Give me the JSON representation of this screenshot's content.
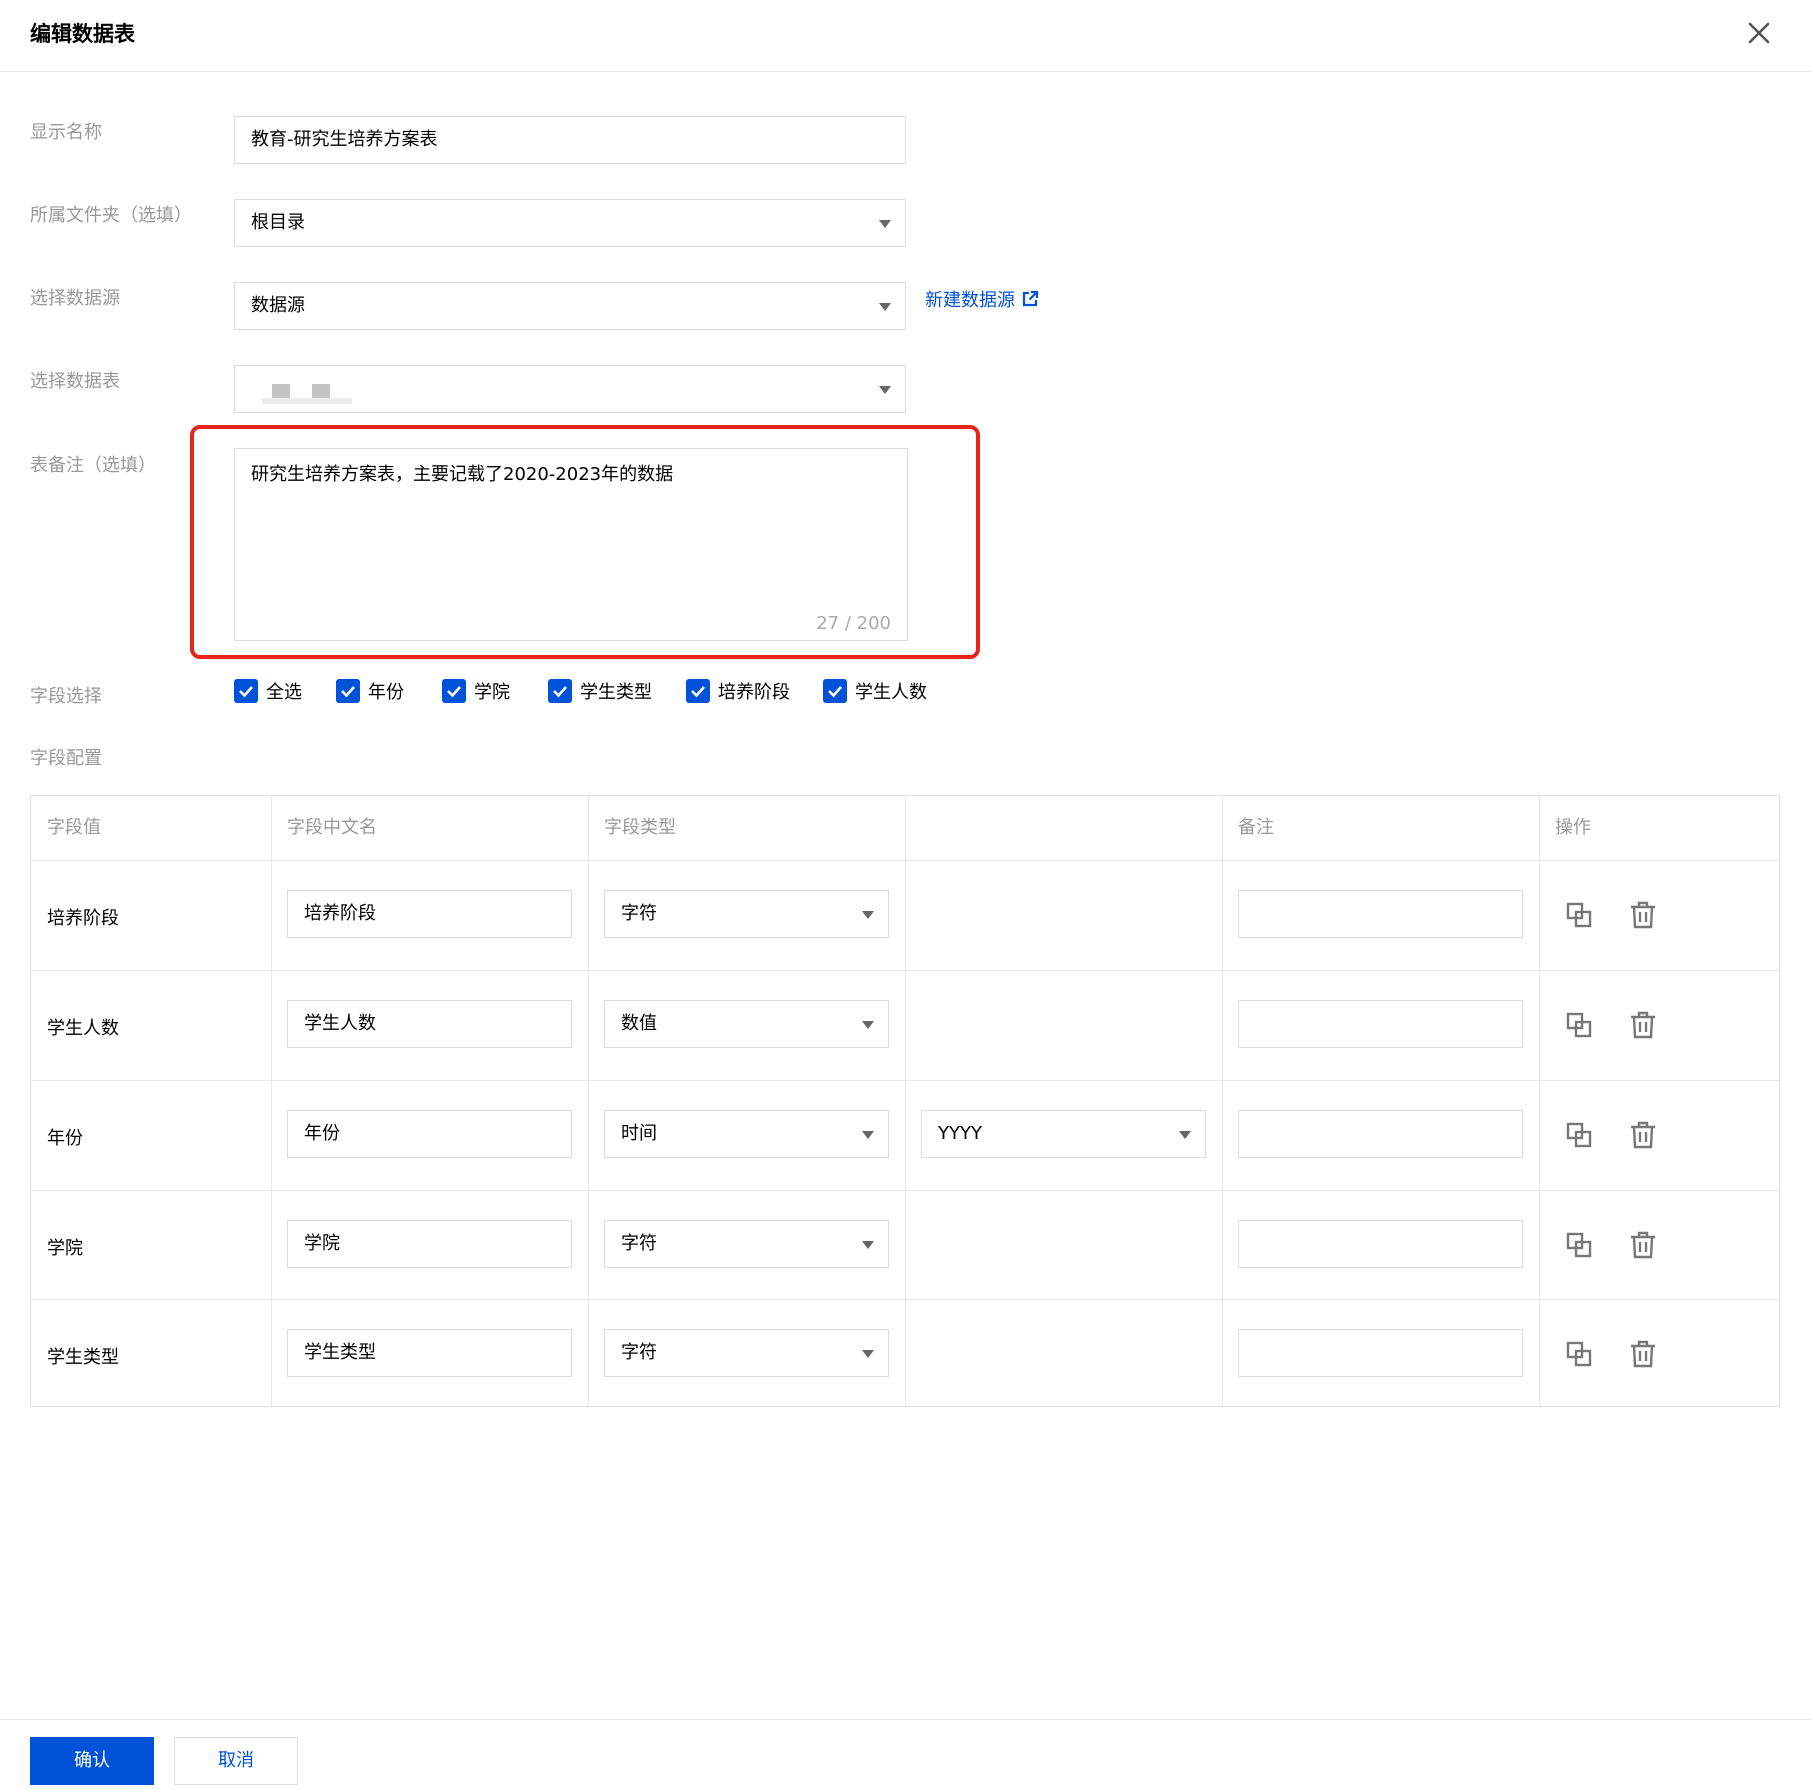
{
  "header": {
    "title": "编辑数据表"
  },
  "form": {
    "display_name": {
      "label": "显示名称",
      "value": "教育-研究生培养方案表"
    },
    "folder": {
      "label": "所属文件夹（选填）",
      "value": "根目录"
    },
    "datasource": {
      "label": "选择数据源",
      "value": "数据源",
      "link": "新建数据源"
    },
    "datatable": {
      "label": "选择数据表",
      "value": ""
    },
    "remark": {
      "label": "表备注（选填）",
      "value": "研究生培养方案表，主要记载了2020-2023年的数据",
      "counter": "27 / 200"
    },
    "field_select": {
      "label": "字段选择",
      "options": [
        {
          "label": "全选",
          "checked": true
        },
        {
          "label": "年份",
          "checked": true
        },
        {
          "label": "学院",
          "checked": true
        },
        {
          "label": "学生类型",
          "checked": true
        },
        {
          "label": "培养阶段",
          "checked": true
        },
        {
          "label": "学生人数",
          "checked": true
        }
      ]
    },
    "field_config_label": "字段配置"
  },
  "table": {
    "headers": [
      "字段值",
      "字段中文名",
      "字段类型",
      "",
      "备注",
      "操作"
    ],
    "rows": [
      {
        "field": "培养阶段",
        "cn_name": "培养阶段",
        "type": "字符",
        "format": "",
        "remark": ""
      },
      {
        "field": "学生人数",
        "cn_name": "学生人数",
        "type": "数值",
        "format": "",
        "remark": ""
      },
      {
        "field": "年份",
        "cn_name": "年份",
        "type": "时间",
        "format": "YYYY",
        "remark": ""
      },
      {
        "field": "学院",
        "cn_name": "学院",
        "type": "字符",
        "format": "",
        "remark": ""
      },
      {
        "field": "学生类型",
        "cn_name": "学生类型",
        "type": "字符",
        "format": "",
        "remark": ""
      }
    ]
  },
  "footer": {
    "confirm": "确认",
    "cancel": "取消"
  },
  "colors": {
    "primary": "#0052d9",
    "highlight": "#e8251a",
    "label": "#999999",
    "border": "#dcdcdc"
  },
  "icons": [
    "close-icon",
    "external-link-icon",
    "check-icon",
    "copy-icon",
    "trash-icon",
    "chevron-down-icon"
  ]
}
